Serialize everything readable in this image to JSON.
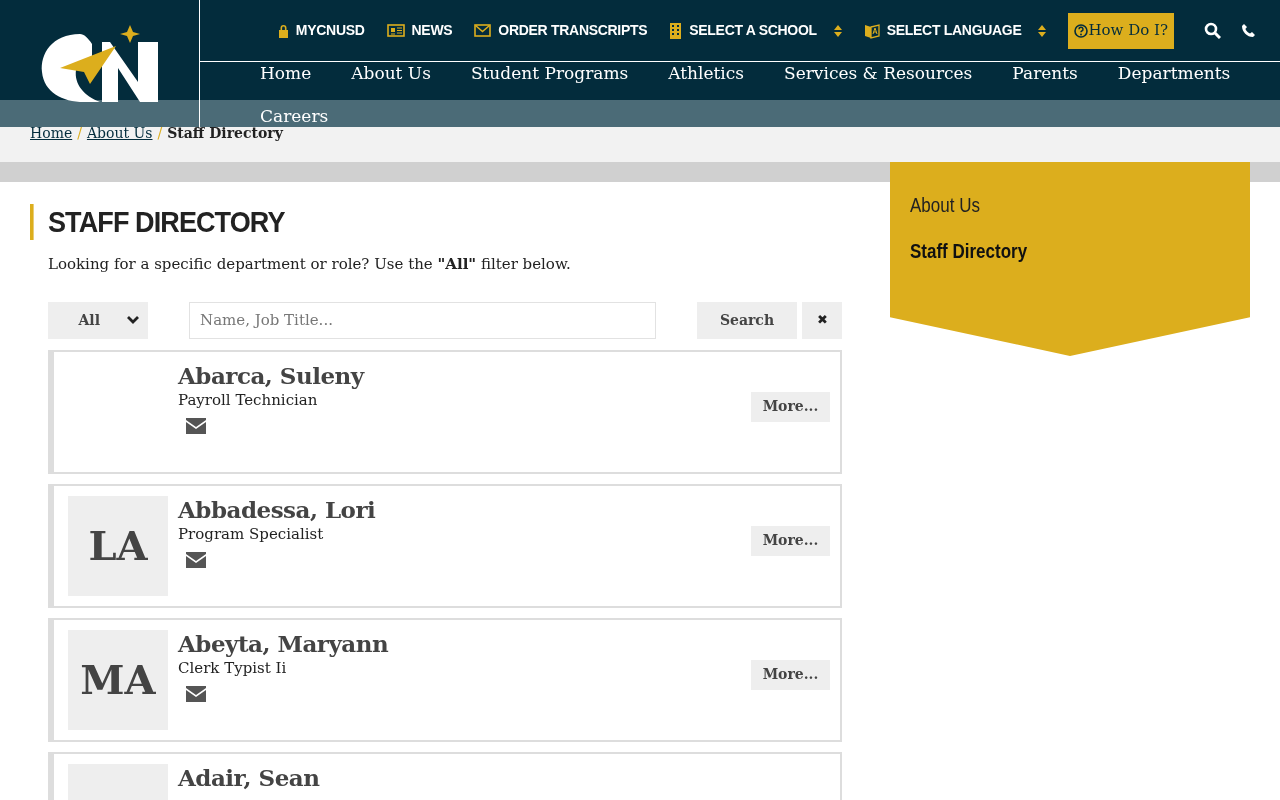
{
  "utility_links": [
    {
      "label": "MYCNUSD",
      "kind": "link"
    },
    {
      "label": "NEWS",
      "kind": "link"
    },
    {
      "label": "ORDER TRANSCRIPTS",
      "kind": "link"
    },
    {
      "label": "SELECT A SCHOOL",
      "kind": "select"
    },
    {
      "label": "SELECT LANGUAGE",
      "kind": "select"
    }
  ],
  "help_button": {
    "label": "How Do I?"
  },
  "nav": [
    "Home",
    "About Us",
    "Student Programs",
    "Athletics",
    "Services & Resources",
    "Parents",
    "Departments",
    "Careers"
  ],
  "breadcrumb": [
    {
      "label": "Home",
      "current": false
    },
    {
      "separator": "/"
    },
    {
      "label": "About Us",
      "current": false
    },
    {
      "separator": "/"
    },
    {
      "label": "Staff Directory",
      "current": true
    }
  ],
  "page_title": "STAFF DIRECTORY",
  "intro": "Looking for a specific department or role? Use the **\"All\"** filter below.",
  "filter": {
    "value": "All"
  },
  "search": {
    "placeholder": "Name, Job Title..."
  },
  "search_button": "Search",
  "clear_button": "✖",
  "staff": [
    {
      "kind": "blank",
      "name": "Abarca, Suleny",
      "title": "Payroll Technician",
      "more": "More..."
    },
    {
      "kind": "initials",
      "initials": "LA",
      "name": "Abbadessa, Lori",
      "title": "Program Specialist",
      "more": "More..."
    },
    {
      "kind": "initials",
      "initials": "MA",
      "name": "Abeyta, Maryann",
      "title": "Clerk Typist Ii",
      "more": "More..."
    },
    {
      "kind": "initials",
      "name": "Adair, Sean"
    }
  ],
  "sidebar": {
    "heading": "About Us",
    "items": [
      {
        "label": "Staff Directory",
        "selected": true
      }
    ]
  }
}
